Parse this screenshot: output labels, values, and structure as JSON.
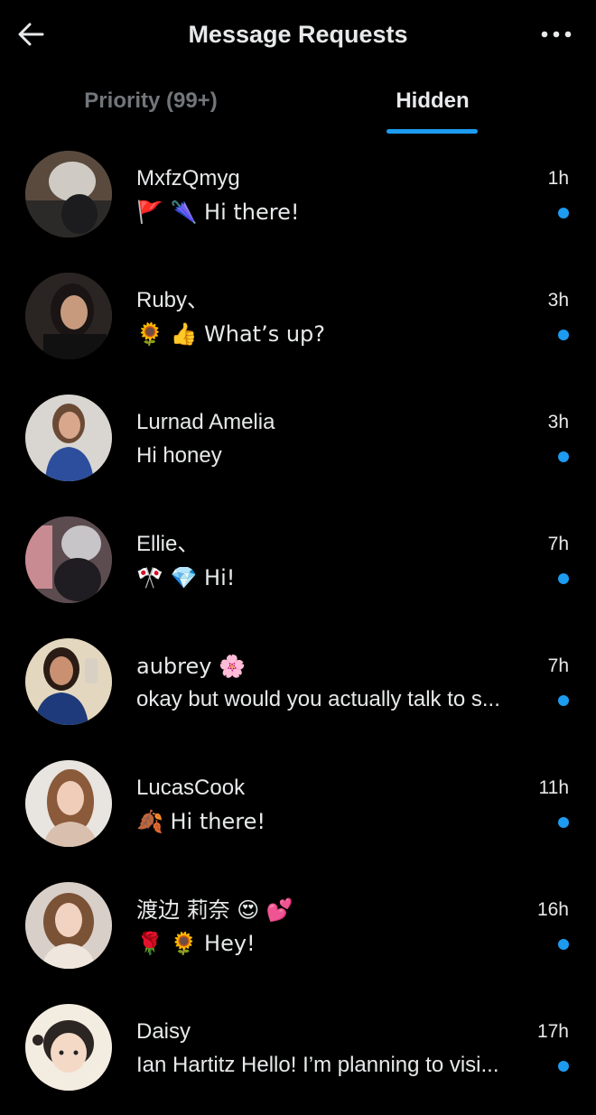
{
  "header": {
    "title": "Message Requests",
    "back_icon": "arrow-left-icon",
    "more_icon": "more-horizontal-icon"
  },
  "tabs": [
    {
      "label": "Priority (99+)",
      "active": false
    },
    {
      "label": "Hidden",
      "active": true
    }
  ],
  "colors": {
    "accent": "#1d9bf0",
    "background": "#000000",
    "text": "#e7e9ea",
    "muted": "#71767b"
  },
  "conversations": [
    {
      "name": "MxfzQmyg",
      "preview": "🚩 🌂 Hi there!",
      "time": "1h",
      "unread": true
    },
    {
      "name": "Ruby、",
      "preview": "🌻 👍 What’s up?",
      "time": "3h",
      "unread": true
    },
    {
      "name": "Lurnad Amelia",
      "preview": "Hi honey",
      "time": "3h",
      "unread": true
    },
    {
      "name": "Ellie、",
      "preview": "🎌 💎 Hi!",
      "time": "7h",
      "unread": true
    },
    {
      "name": "aubrey 🌸",
      "preview": "okay but would you actually talk to s...",
      "time": "7h",
      "unread": true
    },
    {
      "name": "LucasCook",
      "preview": "🍂 Hi there!",
      "time": "11h",
      "unread": true
    },
    {
      "name": "渡边 莉奈 😍 💕",
      "preview": "🌹 🌻 Hey!",
      "time": "16h",
      "unread": true
    },
    {
      "name": "Daisy",
      "preview": "Ian Hartitz Hello! I’m planning to visi...",
      "time": "17h",
      "unread": true
    }
  ]
}
